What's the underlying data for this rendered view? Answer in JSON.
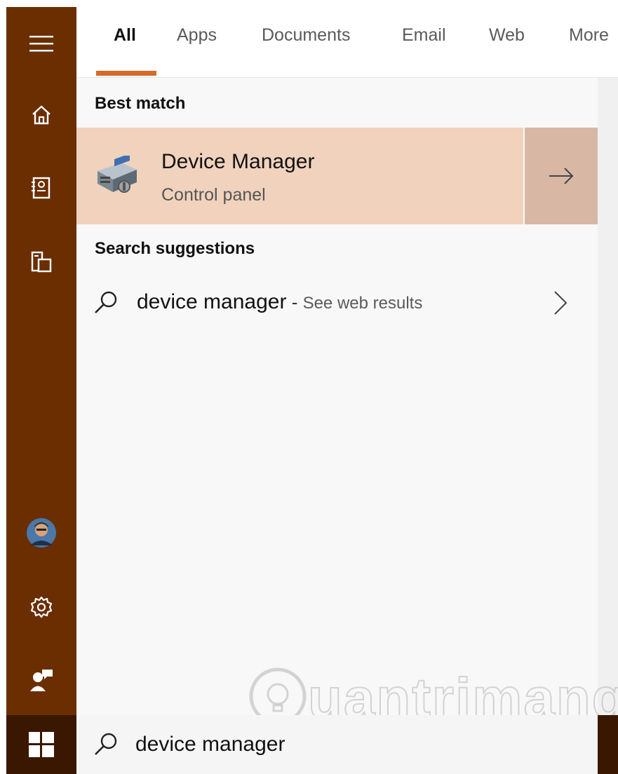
{
  "tabs": [
    {
      "label": "All",
      "active": true
    },
    {
      "label": "Apps"
    },
    {
      "label": "Documents"
    },
    {
      "label": "Email"
    },
    {
      "label": "Web"
    },
    {
      "label": "More"
    }
  ],
  "rail": {
    "items": [
      {
        "icon": "hamburger-menu-icon"
      },
      {
        "icon": "home-icon"
      },
      {
        "icon": "notebook-icon"
      },
      {
        "icon": "devices-icon"
      },
      {
        "icon": "user-avatar"
      },
      {
        "icon": "gear-icon"
      },
      {
        "icon": "feedback-icon"
      }
    ]
  },
  "best_match": {
    "title": "Best match",
    "item": {
      "name": "Device Manager",
      "subtitle": "Control panel",
      "icon": "device-manager-icon"
    }
  },
  "suggestions": {
    "title": "Search suggestions",
    "items": [
      {
        "query": "device manager",
        "separator": " - ",
        "extra": "See web results"
      }
    ]
  },
  "search": {
    "value": "device manager",
    "icon": "search-icon"
  },
  "watermark": {
    "text": "uantrimang"
  },
  "colors": {
    "rail": "#6b2e00",
    "start": "#3a1700",
    "accent": "#d46b2a",
    "selected_row": "#f0d2bd",
    "selected_arrow": "#d8b8a4"
  }
}
